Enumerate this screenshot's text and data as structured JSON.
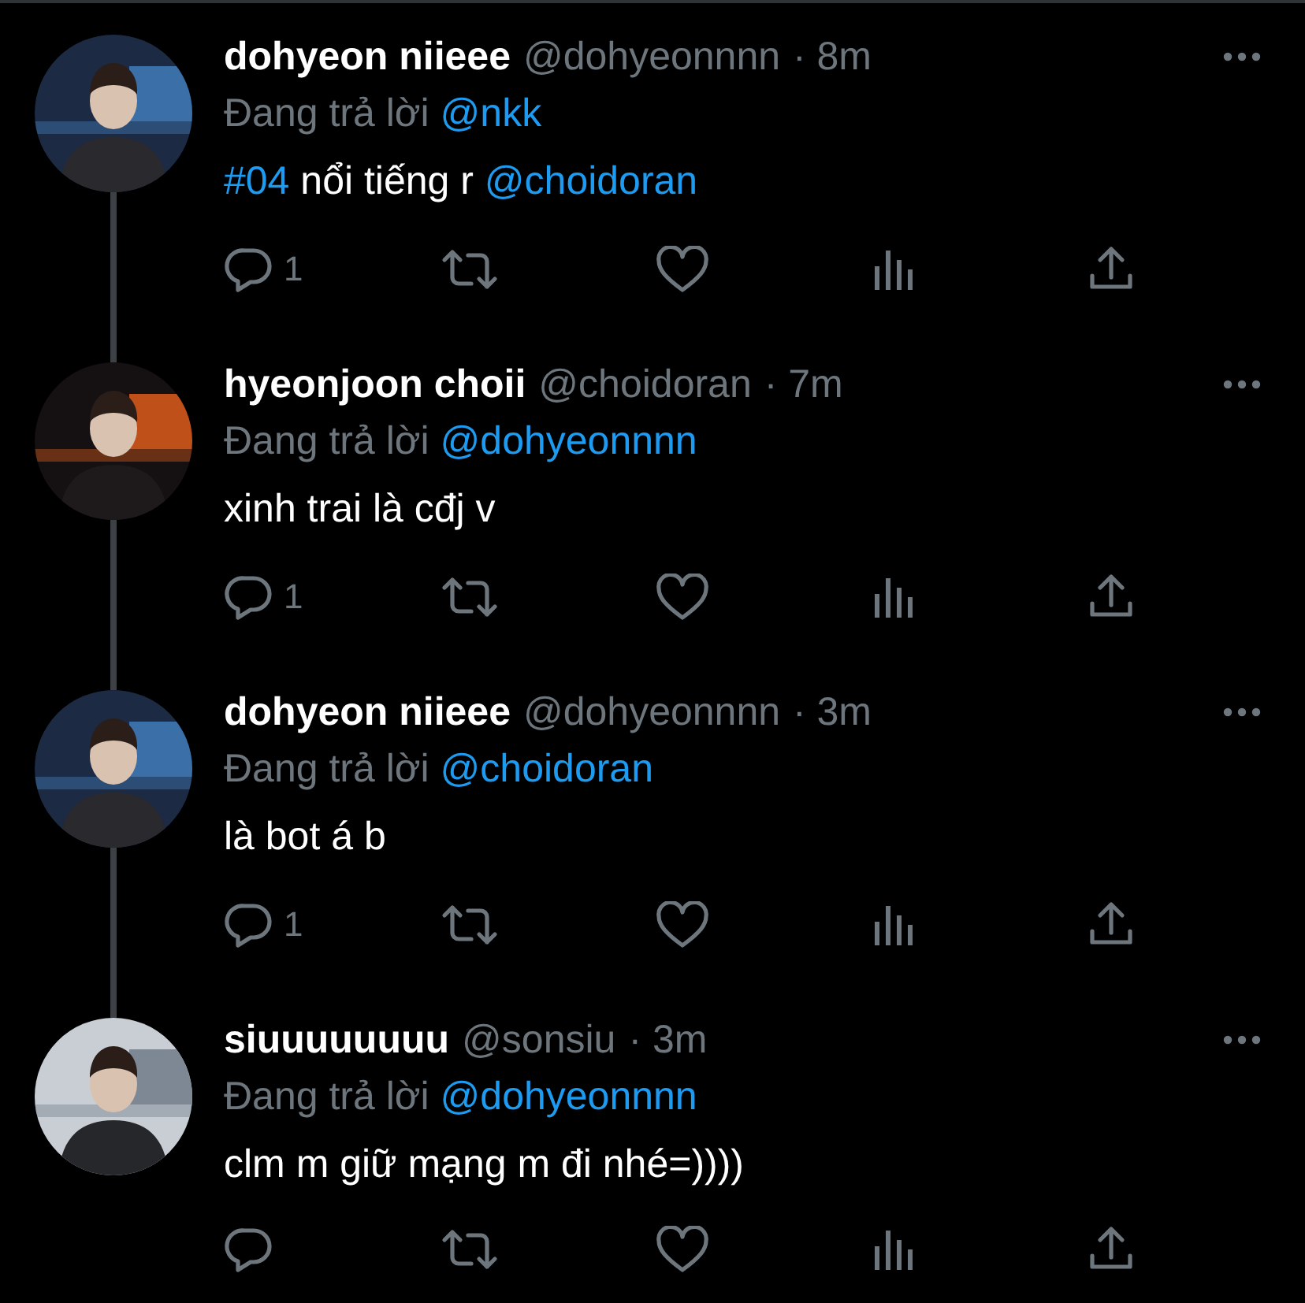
{
  "tweets": [
    {
      "avatar": {
        "kind": "picture"
      },
      "name": "dohyeon niieee",
      "handle": "@dohyeonnnn",
      "time": "· 8m",
      "reply_prefix": "Đang trả lời",
      "reply_to": "@nkk",
      "thread_continues": true,
      "body": [
        {
          "kind": "link",
          "text": "#04"
        },
        {
          "kind": "text",
          "text": " nổi tiếng r "
        },
        {
          "kind": "link",
          "text": "@choidoran"
        }
      ],
      "reply_count": "1"
    },
    {
      "avatar": {
        "kind": "picture"
      },
      "name": "hyeonjoon choii",
      "handle": "@choidoran",
      "time": "· 7m",
      "reply_prefix": "Đang trả lời",
      "reply_to": "@dohyeonnnn",
      "thread_continues": true,
      "body": [
        {
          "kind": "text",
          "text": "xinh trai là cđj v"
        }
      ],
      "reply_count": "1"
    },
    {
      "avatar": {
        "kind": "picture"
      },
      "name": "dohyeon niieee",
      "handle": "@dohyeonnnn",
      "time": "· 3m",
      "reply_prefix": "Đang trả lời",
      "reply_to": "@choidoran",
      "thread_continues": true,
      "body": [
        {
          "kind": "text",
          "text": "là bot á b"
        }
      ],
      "reply_count": "1"
    },
    {
      "avatar": {
        "kind": "picture"
      },
      "name": "siuuuuuuuu",
      "handle": "@sonsiu",
      "time": "· 3m",
      "reply_prefix": "Đang trả lời",
      "reply_to": "@dohyeonnnn",
      "thread_continues": false,
      "body": [
        {
          "kind": "text",
          "text": "clm m giữ mạng m đi nhé=))))"
        }
      ]
    }
  ]
}
